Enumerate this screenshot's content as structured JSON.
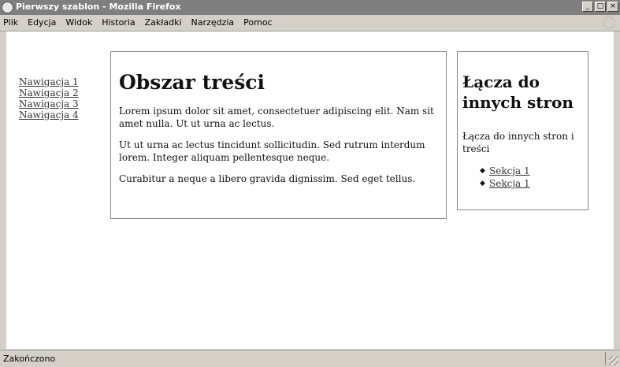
{
  "window": {
    "title": "Pierwszy szablon - Mozilla Firefox",
    "controls": {
      "minimize": "_",
      "maximize": "□",
      "close": "×"
    }
  },
  "menu": {
    "items": [
      "Plik",
      "Edycja",
      "Widok",
      "Historia",
      "Zakładki",
      "Narzędzia",
      "Pomoc"
    ]
  },
  "nav": {
    "links": [
      "Nawigacja 1",
      "Nawigacja 2",
      "Nawigacja 3",
      "Nawigacja 4"
    ]
  },
  "main": {
    "heading": "Obszar treści",
    "paragraphs": [
      "Lorem ipsum dolor sit amet, consectetuer adipiscing elit. Nam sit amet nulla. Ut ut urna ac lectus.",
      "Ut ut urna ac lectus tincidunt sollicitudin. Sed rutrum interdum lorem. Integer aliquam pellentesque neque.",
      "Curabitur a neque a libero gravida dignissim. Sed eget tellus."
    ]
  },
  "sidebar": {
    "heading": "Łącza do innych stron",
    "text": "Łącza do innych stron i treści",
    "links": [
      "Sekcja 1",
      "Sekcja 1"
    ]
  },
  "status": {
    "text": "Zakończono"
  }
}
